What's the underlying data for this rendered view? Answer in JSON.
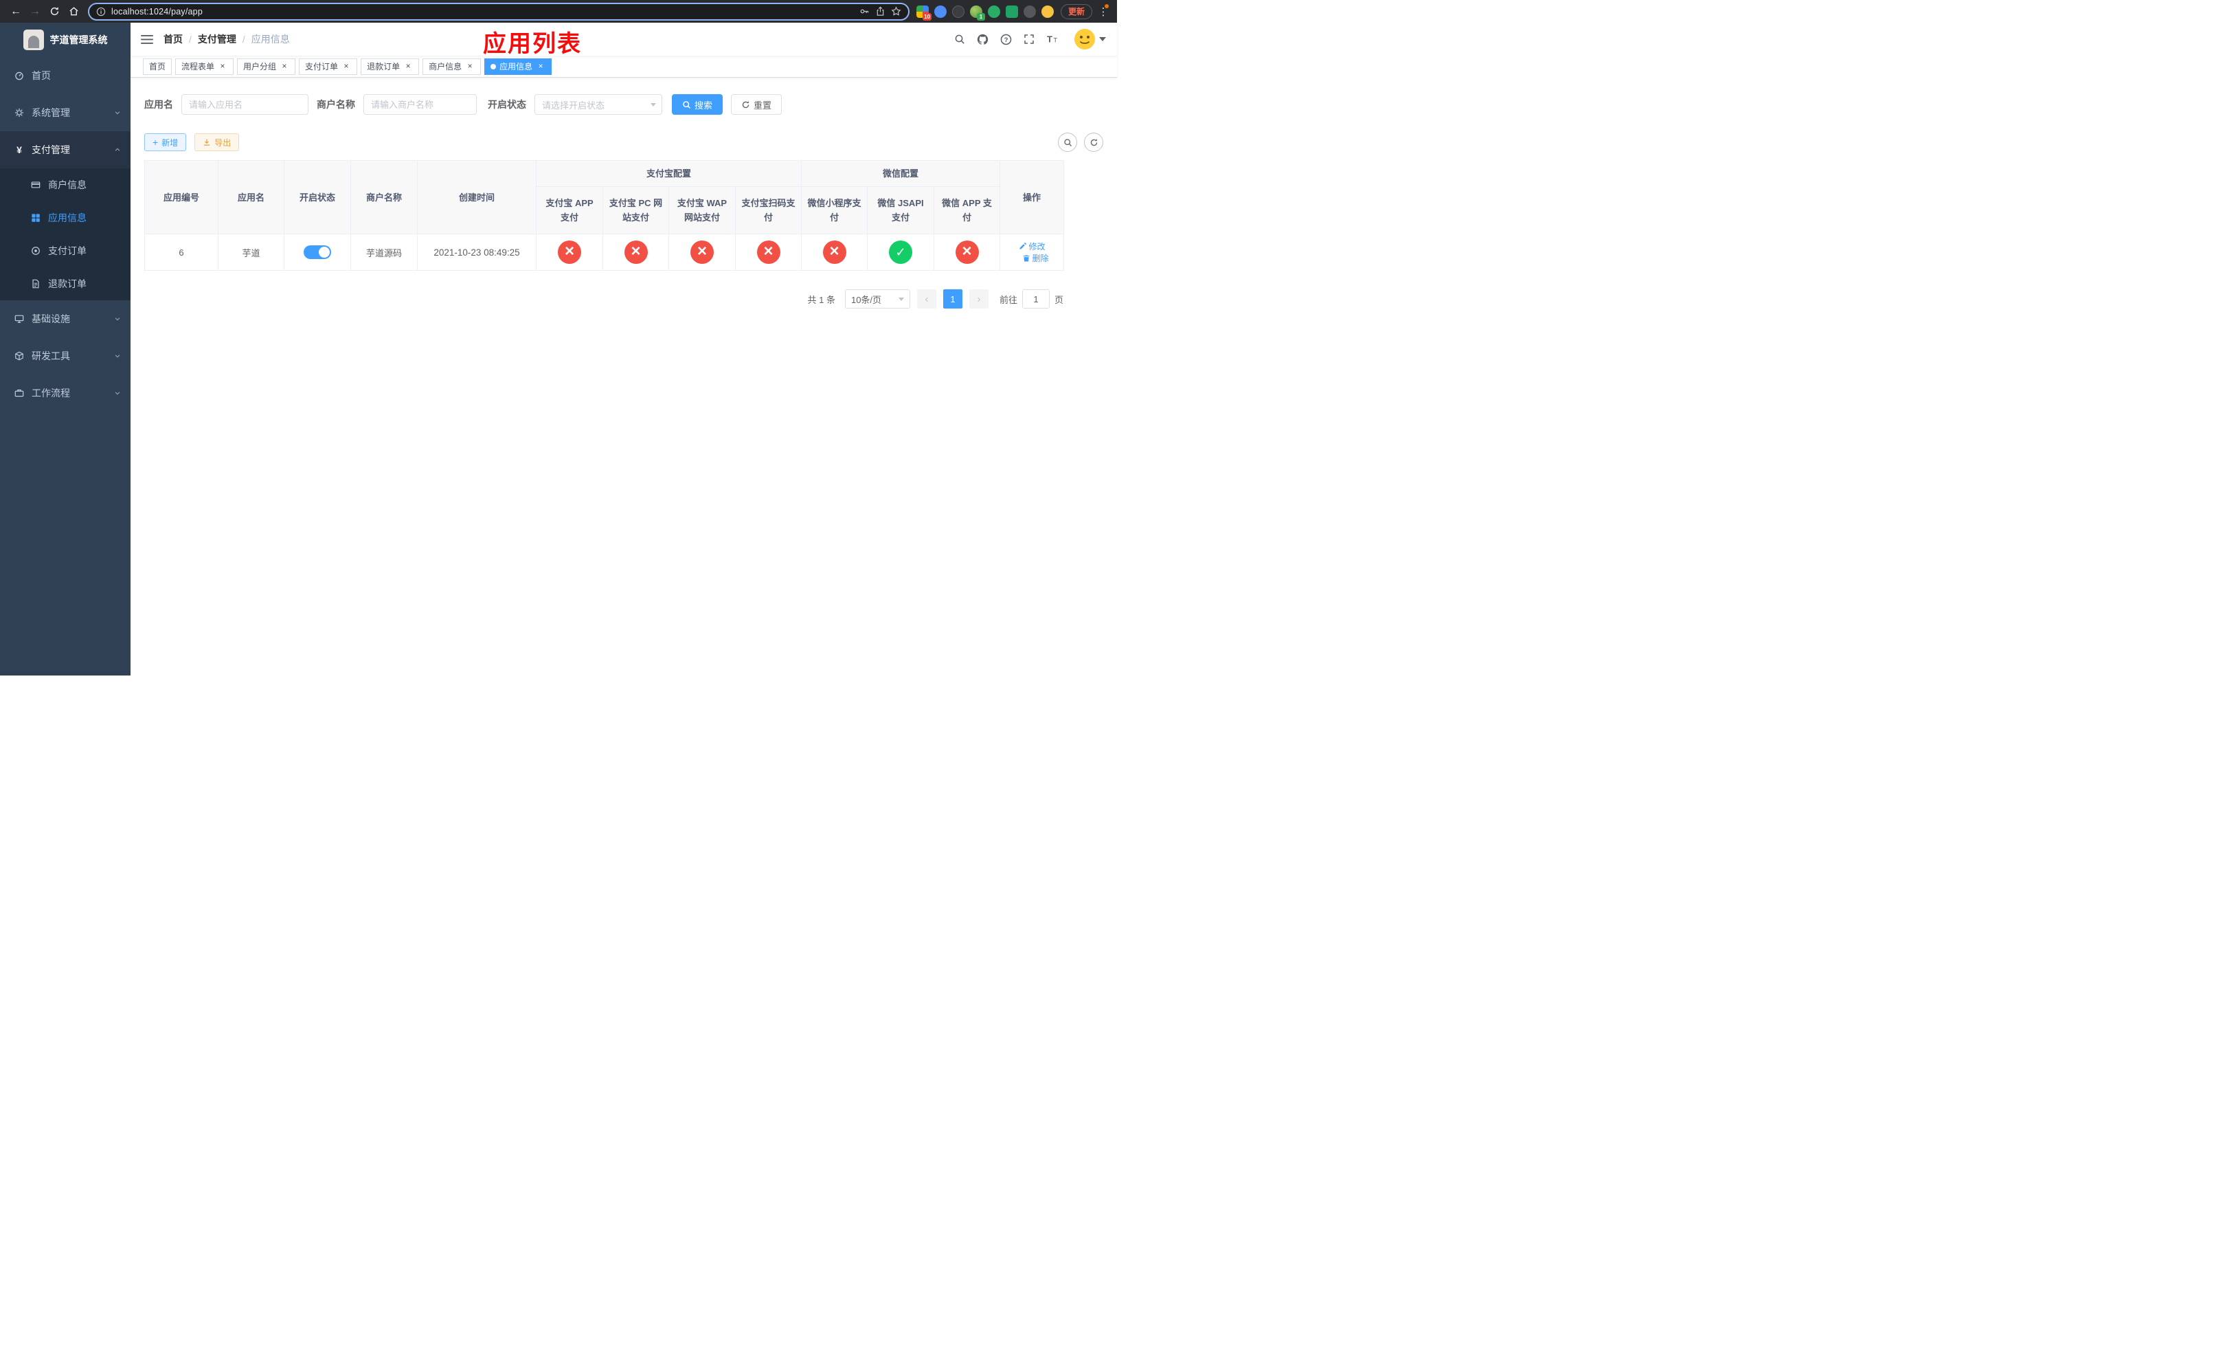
{
  "browser": {
    "url": "localhost:1024/pay/app",
    "update_label": "更新",
    "ext_badge_grid": "10",
    "ext_badge_avatar": "1"
  },
  "sidebar": {
    "title": "芋道管理系统",
    "items": [
      {
        "label": "首页"
      },
      {
        "label": "系统管理"
      },
      {
        "label": "支付管理"
      },
      {
        "label": "基础设施"
      },
      {
        "label": "研发工具"
      },
      {
        "label": "工作流程"
      }
    ],
    "submenu": [
      {
        "label": "商户信息"
      },
      {
        "label": "应用信息"
      },
      {
        "label": "支付订单"
      },
      {
        "label": "退款订单"
      }
    ]
  },
  "breadcrumb": {
    "items": [
      "首页",
      "支付管理",
      "应用信息"
    ]
  },
  "annotation": "应用列表",
  "tabs": [
    {
      "label": "首页"
    },
    {
      "label": "流程表单"
    },
    {
      "label": "用户分组"
    },
    {
      "label": "支付订单"
    },
    {
      "label": "退款订单"
    },
    {
      "label": "商户信息"
    },
    {
      "label": "应用信息"
    }
  ],
  "filters": {
    "app_name_label": "应用名",
    "app_name_placeholder": "请输入应用名",
    "merchant_label": "商户名称",
    "merchant_placeholder": "请输入商户名称",
    "status_label": "开启状态",
    "status_placeholder": "请选择开启状态",
    "search_label": "搜索",
    "reset_label": "重置"
  },
  "toolbar": {
    "add_label": "新增",
    "export_label": "导出"
  },
  "table": {
    "group_alipay": "支付宝配置",
    "group_wechat": "微信配置",
    "col_app_id": "应用编号",
    "col_app_name": "应用名",
    "col_status": "开启状态",
    "col_merchant": "商户名称",
    "col_created": "创建时间",
    "col_alipay_app": "支付宝 APP 支付",
    "col_alipay_pc": "支付宝 PC 网站支付",
    "col_alipay_wap": "支付宝 WAP 网站支付",
    "col_alipay_qr": "支付宝扫码支付",
    "col_wx_mini": "微信小程序支付",
    "col_wx_jsapi": "微信 JSAPI 支付",
    "col_wx_app": "微信 APP 支付",
    "col_actions": "操作",
    "row": {
      "app_id": "6",
      "app_name": "芋道",
      "status": "on",
      "merchant": "芋道源码",
      "created": "2021-10-23 08:49:25",
      "alipay_app": "disabled",
      "alipay_pc": "disabled",
      "alipay_wap": "disabled",
      "alipay_qr": "disabled",
      "wx_mini": "disabled",
      "wx_jsapi": "enabled",
      "wx_app": "disabled",
      "edit_label": "修改",
      "delete_label": "删除"
    }
  },
  "pagination": {
    "total": "共 1 条",
    "page_size": "10条/页",
    "page": "1",
    "goto_label": "前往",
    "goto_value": "1",
    "goto_suffix": "页"
  }
}
